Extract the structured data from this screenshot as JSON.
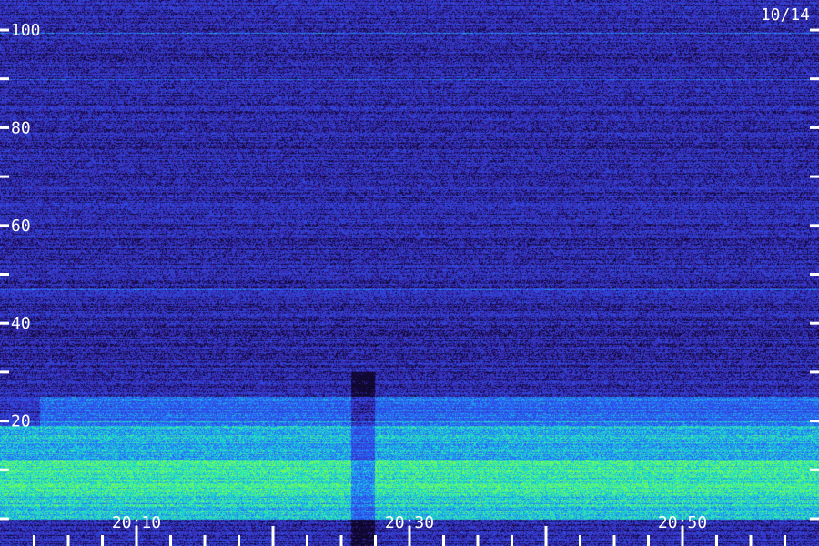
{
  "chart_data": {
    "type": "heatmap",
    "date_label": "10/14",
    "y_axis": {
      "range": [
        0,
        100
      ],
      "tick_labels": [
        {
          "value": 100,
          "label": "100"
        },
        {
          "value": 80,
          "label": "80"
        },
        {
          "value": 60,
          "label": "60"
        },
        {
          "value": 40,
          "label": "40"
        },
        {
          "value": 20,
          "label": "20"
        }
      ],
      "minor_ticks": [
        0,
        10,
        30,
        50,
        70,
        90
      ]
    },
    "x_axis": {
      "range_minutes": [
        0,
        60
      ],
      "tick_labels": [
        {
          "minute": 10,
          "label": "20:10"
        },
        {
          "minute": 30,
          "label": "20:30"
        },
        {
          "minute": 50,
          "label": "20:50"
        }
      ],
      "minor_ticks_every_minutes": 2.5
    },
    "bands": [
      {
        "from": 0,
        "to": 5,
        "intensity": 0.75
      },
      {
        "from": 5,
        "to": 12,
        "intensity": 0.85
      },
      {
        "from": 12,
        "to": 19,
        "intensity": 0.7
      },
      {
        "from": 19,
        "to": 25,
        "intensity": 0.5
      }
    ],
    "horizontal_lines": [
      99.5,
      90,
      47,
      20
    ],
    "colors": {
      "background": "#2a1a6e",
      "low": "#3a22a0",
      "mid": "#2a5cff",
      "high": "#19e0d0",
      "peak": "#7cff4a",
      "axis": "#ffffff"
    }
  }
}
